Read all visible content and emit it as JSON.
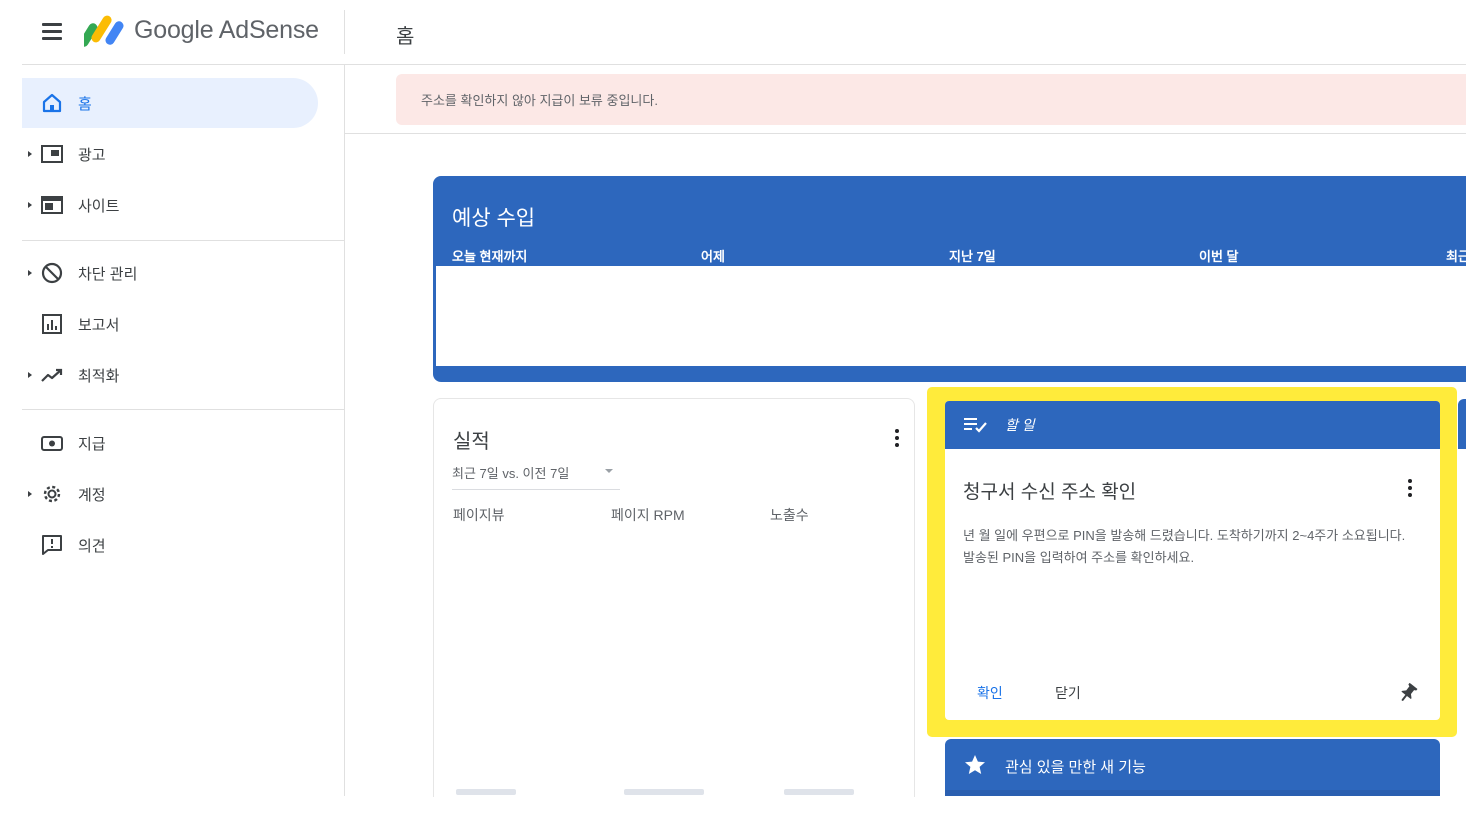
{
  "header": {
    "brand": "Google AdSense",
    "page_title": "홈"
  },
  "sidebar": {
    "items": [
      {
        "label": "홈",
        "icon": "home-icon",
        "active": true
      },
      {
        "label": "광고",
        "icon": "ads-icon"
      },
      {
        "label": "사이트",
        "icon": "sites-icon"
      },
      {
        "label": "차단 관리",
        "icon": "block-icon"
      },
      {
        "label": "보고서",
        "icon": "reports-icon"
      },
      {
        "label": "최적화",
        "icon": "optimization-icon"
      },
      {
        "label": "지급",
        "icon": "payments-icon"
      },
      {
        "label": "계정",
        "icon": "settings-icon"
      },
      {
        "label": "의견",
        "icon": "feedback-icon"
      }
    ]
  },
  "alert": {
    "text": "주소를 확인하지 않아 지급이 보류 중입니다."
  },
  "revenue": {
    "title": "예상 수입",
    "columns": [
      "오늘 현재까지",
      "어제",
      "지난 7일",
      "이번 달",
      "최근"
    ]
  },
  "performance": {
    "title": "실적",
    "period": "최근 7일 vs. 이전 7일",
    "columns": [
      "페이지뷰",
      "페이지 RPM",
      "노출수"
    ]
  },
  "todo": {
    "header": "할 일",
    "title": "청구서 수신 주소 확인",
    "body": "년 월 일에 우편으로 PIN을 발송해 드렸습니다. 도착하기까지 2~4주가 소요됩니다. 발송된 PIN을 입력하여 주소를 확인하세요.",
    "confirm_label": "확인",
    "close_label": "닫기"
  },
  "new_features": {
    "label": "관심 있을 만한 새 기능"
  },
  "colors": {
    "primary_blue": "#2d67bd",
    "highlight": "#ffeb3b",
    "alert_bg": "#fce8e6",
    "active_nav_bg": "#e8f0fe",
    "link_blue": "#1a73e8"
  }
}
